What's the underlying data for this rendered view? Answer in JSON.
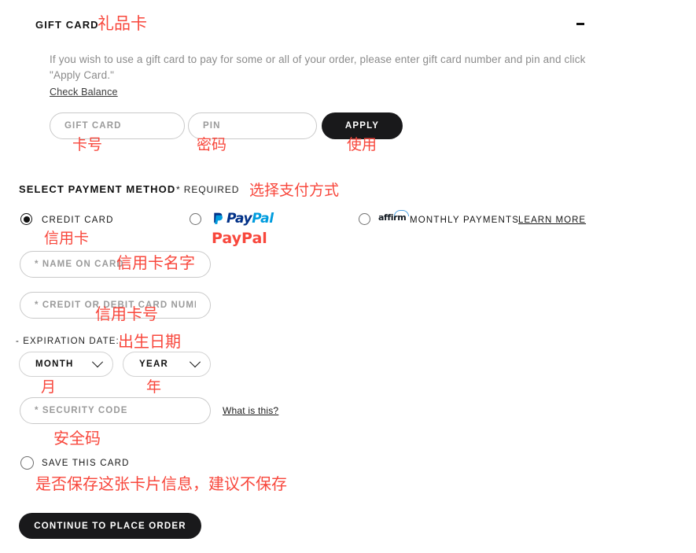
{
  "gift_card": {
    "title": "GIFT CARD",
    "collapse_icon": "minus-icon",
    "description": "If you wish to use a gift card to pay for some or all of your order, please enter gift card number and pin and click \"Apply Card.\"",
    "check_balance_link": "Check Balance",
    "card_number_placeholder": "GIFT CARD",
    "pin_placeholder": "PIN",
    "card_number_value": "",
    "pin_value": "",
    "apply_label": "APPLY"
  },
  "payment_method": {
    "title": "SELECT PAYMENT METHOD",
    "required_note": "* REQUIRED",
    "options": [
      {
        "id": "credit-card",
        "label": "CREDIT CARD",
        "selected": true
      },
      {
        "id": "paypal",
        "label": "PayPal",
        "logo_pay": "Pay",
        "logo_pal": "Pal",
        "selected": false
      },
      {
        "id": "affirm",
        "label": "MONTHLY PAYMENTS",
        "logo": "affirm",
        "learn_more": "LEARN MORE",
        "selected": false
      }
    ]
  },
  "credit_card_form": {
    "name_on_card_placeholder": "* NAME ON CARD",
    "name_on_card_value": "",
    "card_number_placeholder": "* CREDIT OR DEBIT CARD NUMBER",
    "card_number_value": "",
    "expiration_label": "- EXPIRATION DATE:",
    "month_value": "MONTH",
    "year_value": "YEAR",
    "security_code_placeholder": "* SECURITY CODE",
    "security_code_value": "",
    "what_is_this_link": "What is this?",
    "save_card_label": "SAVE THIS CARD",
    "save_card_checked": false,
    "submit_label": "CONTINUE TO PLACE ORDER"
  },
  "annotations": {
    "color": "#f8473c",
    "gift_card": "礼品卡",
    "gift_card_number": "卡号",
    "pin": "密码",
    "apply": "使用",
    "select_payment_method": "选择支付方式",
    "credit_card": "信用卡",
    "paypal": "PayPal",
    "name_on_card": "信用卡名字",
    "card_number": "信用卡号",
    "expiration_date": "出生日期",
    "month": "月",
    "year": "年",
    "security_code": "安全码",
    "save_card": "是否保存这张卡片信息，建议不保存"
  }
}
